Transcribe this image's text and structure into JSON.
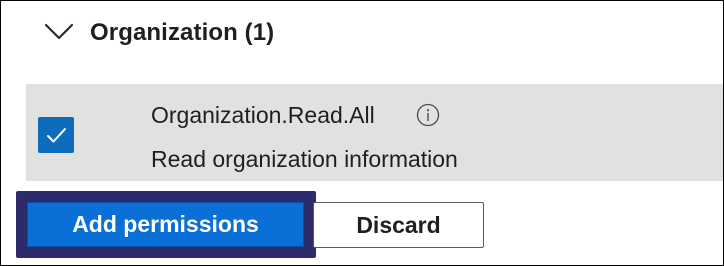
{
  "group": {
    "title": "Organization (1)",
    "expanded": true
  },
  "permission": {
    "name": "Organization.Read.All",
    "description": "Read organization information",
    "checked": true,
    "info_symbol": "i"
  },
  "actions": {
    "add_label": "Add permissions",
    "discard_label": "Discard"
  },
  "colors": {
    "accent": "#0f6cbd",
    "primary_button": "#0a6fd6",
    "highlight_frame": "#2c2c6c",
    "row_background": "#e1e1e1"
  },
  "icons": {
    "expand": "chevron-down-icon",
    "checkbox": "checkmark-icon",
    "info": "info-icon"
  }
}
